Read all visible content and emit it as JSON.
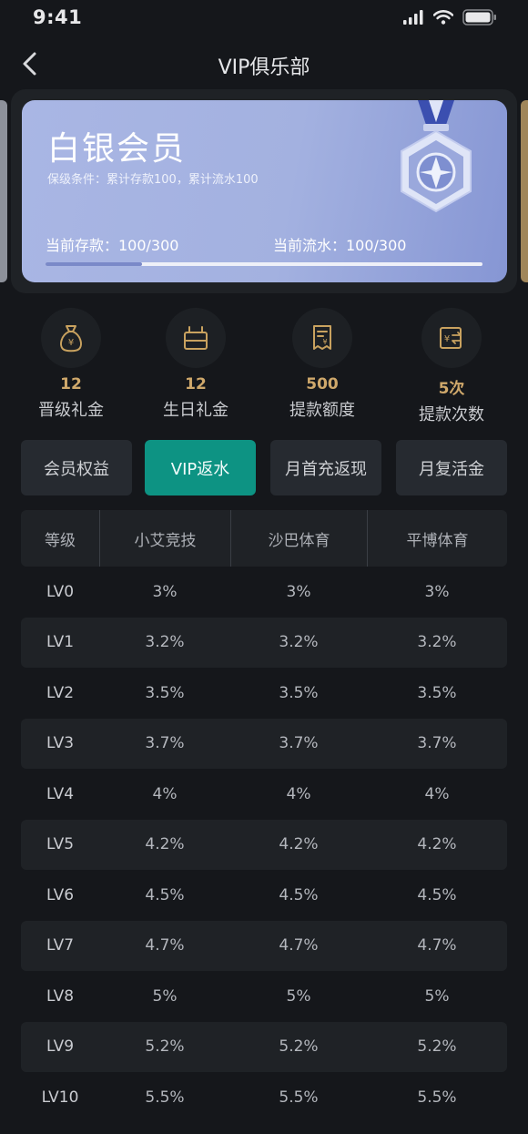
{
  "status_bar": {
    "time": "9:41"
  },
  "header": {
    "title": "VIP俱乐部"
  },
  "card": {
    "level_name": "白银会员",
    "condition": "保级条件：累计存款100，累计流水100",
    "deposit_text": "当前存款：100/300",
    "flow_text": "当前流水：100/300",
    "progress_fraction": 0.22,
    "accent": "#a3b1e0"
  },
  "perks": [
    {
      "icon": "money-bag-icon",
      "value": "12",
      "label": "晋级礼金"
    },
    {
      "icon": "gift-box-icon",
      "value": "12",
      "label": "生日礼金"
    },
    {
      "icon": "receipt-icon",
      "value": "500",
      "label": "提款额度"
    },
    {
      "icon": "exchange-icon",
      "value": "5次",
      "label": "提款次数"
    }
  ],
  "tabs": [
    {
      "label": "会员权益",
      "active": false
    },
    {
      "label": "VIP返水",
      "active": true
    },
    {
      "label": "月首充返现",
      "active": false
    },
    {
      "label": "月复活金",
      "active": false
    }
  ],
  "table": {
    "headers": [
      "等级",
      "小艾竞技",
      "沙巴体育",
      "平博体育"
    ],
    "rows": [
      [
        "LV0",
        "3%",
        "3%",
        "3%"
      ],
      [
        "LV1",
        "3.2%",
        "3.2%",
        "3.2%"
      ],
      [
        "LV2",
        "3.5%",
        "3.5%",
        "3.5%"
      ],
      [
        "LV3",
        "3.7%",
        "3.7%",
        "3.7%"
      ],
      [
        "LV4",
        "4%",
        "4%",
        "4%"
      ],
      [
        "LV5",
        "4.2%",
        "4.2%",
        "4.2%"
      ],
      [
        "LV6",
        "4.5%",
        "4.5%",
        "4.5%"
      ],
      [
        "LV7",
        "4.7%",
        "4.7%",
        "4.7%"
      ],
      [
        "LV8",
        "5%",
        "5%",
        "5%"
      ],
      [
        "LV9",
        "5.2%",
        "5.2%",
        "5.2%"
      ],
      [
        "LV10",
        "5.5%",
        "5.5%",
        "5.5%"
      ]
    ]
  },
  "colors": {
    "background": "#15171b",
    "gold": "#cfa86b",
    "active_tab": "#0d9383"
  }
}
